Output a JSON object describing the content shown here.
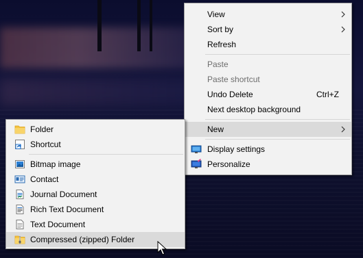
{
  "main_menu": {
    "items": [
      {
        "label": "View"
      },
      {
        "label": "Sort by"
      },
      {
        "label": "Refresh"
      },
      {
        "label": "Paste"
      },
      {
        "label": "Paste shortcut"
      },
      {
        "label": "Undo Delete",
        "shortcut": "Ctrl+Z"
      },
      {
        "label": "Next desktop background"
      },
      {
        "label": "New"
      },
      {
        "label": "Display settings"
      },
      {
        "label": "Personalize"
      }
    ]
  },
  "new_submenu": {
    "items": [
      {
        "label": "Folder"
      },
      {
        "label": "Shortcut"
      },
      {
        "label": "Bitmap image"
      },
      {
        "label": "Contact"
      },
      {
        "label": "Journal Document"
      },
      {
        "label": "Rich Text Document"
      },
      {
        "label": "Text Document"
      },
      {
        "label": "Compressed (zipped) Folder"
      }
    ]
  },
  "colors": {
    "menu_background": "#f2f2f2",
    "highlight": "#dadada",
    "disabled_text": "#6d6d6d",
    "folder_yellow": "#f5c342",
    "accent_blue": "#1e6fc9"
  }
}
